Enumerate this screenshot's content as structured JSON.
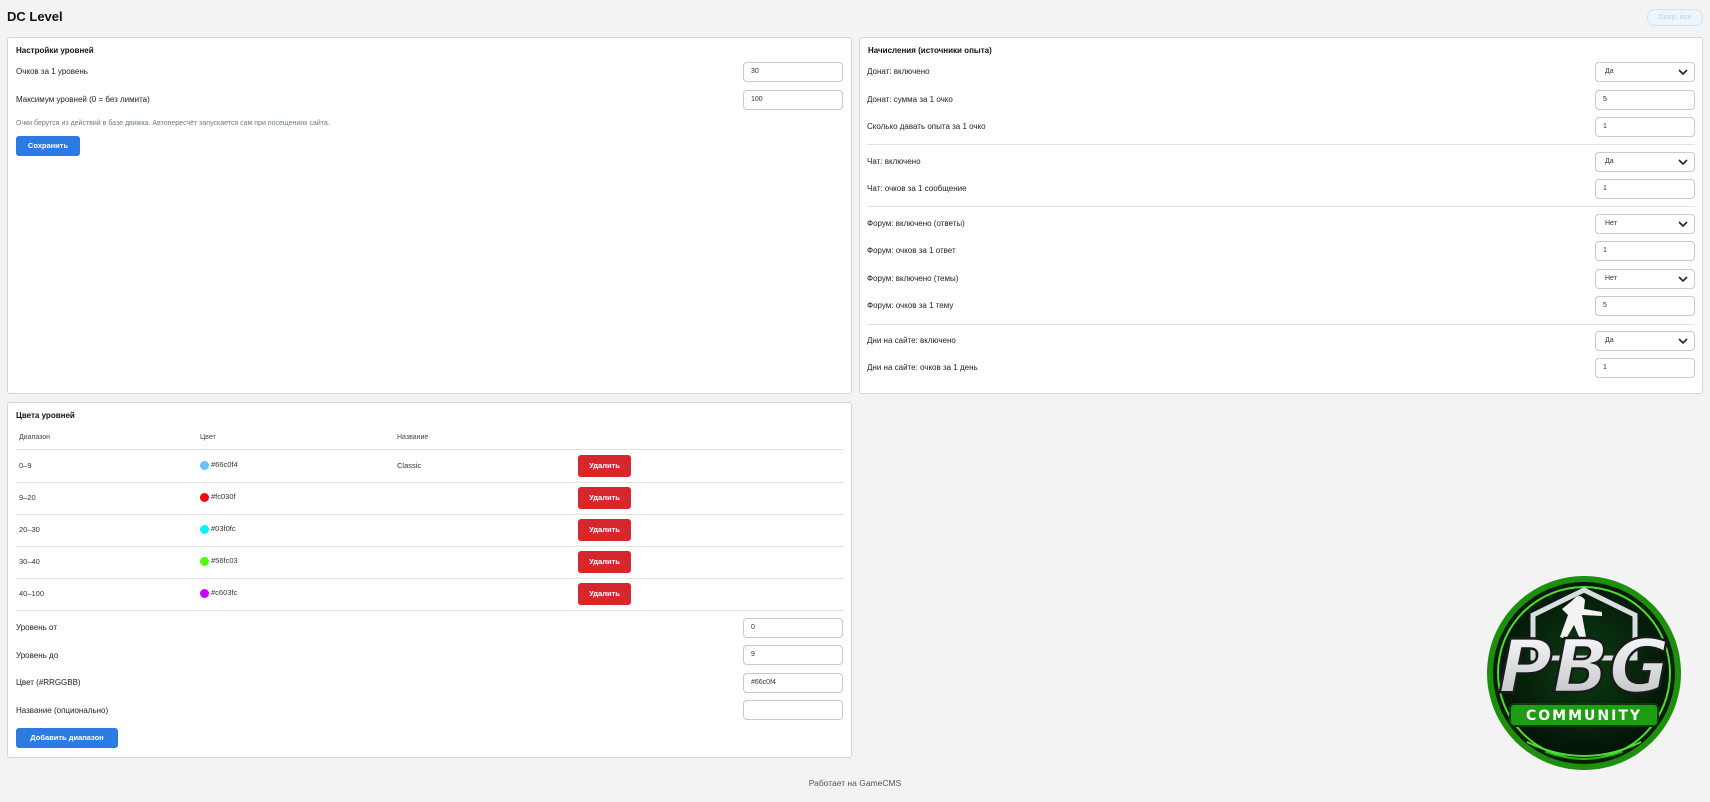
{
  "header": {
    "title": "DC Level",
    "top_button_label": "Сохр. все"
  },
  "level_settings": {
    "title": "Настройки уровней",
    "points_per_level": {
      "label": "Очков за 1 уровень",
      "value": "30"
    },
    "max_levels": {
      "label": "Максимум уровней (0 = без лимита)",
      "value": "100"
    },
    "hint": "Очки берутся из действий в базе движка. Автопересчёт запускается сам при посещениях сайта.",
    "save_label": "Сохранить"
  },
  "accruals": {
    "title": "Начисления (источники опыта)",
    "rows": [
      {
        "label": "Донат: включено",
        "type": "select",
        "value": "Да"
      },
      {
        "label": "Донат: сумма за 1 очко",
        "type": "input",
        "value": "5"
      },
      {
        "label": "Сколько давать опыта за 1 очко",
        "type": "input",
        "value": "1"
      },
      {
        "label": "Чат: включено",
        "type": "select",
        "value": "Да"
      },
      {
        "label": "Чат: очков за 1 сообщение",
        "type": "input",
        "value": "1"
      },
      {
        "label": "Форум: включено (ответы)",
        "type": "select",
        "value": "Нет"
      },
      {
        "label": "Форум: очков за 1 ответ",
        "type": "input",
        "value": "1"
      },
      {
        "label": "Форум: включено (темы)",
        "type": "select",
        "value": "Нет"
      },
      {
        "label": "Форум: очков за 1 тему",
        "type": "input",
        "value": "5"
      },
      {
        "label": "Дни на сайте: включено",
        "type": "select",
        "value": "Да"
      },
      {
        "label": "Дни на сайте: очков за 1 день",
        "type": "input",
        "value": "1"
      }
    ]
  },
  "level_colors": {
    "title": "Цвета уровней",
    "columns": [
      "Диапазон",
      "Цвет",
      "Название"
    ],
    "delete_label": "Удалить",
    "rows": [
      {
        "range": "0–9",
        "color": "#66c0f4",
        "name": "Classic"
      },
      {
        "range": "9–20",
        "color": "#fc030f",
        "name": ""
      },
      {
        "range": "20–30",
        "color": "#03f0fc",
        "name": ""
      },
      {
        "range": "30–40",
        "color": "#56fc03",
        "name": ""
      },
      {
        "range": "40–100",
        "color": "#c603fc",
        "name": ""
      }
    ],
    "form": {
      "level_from": {
        "label": "Уровень от",
        "value": "0"
      },
      "level_to": {
        "label": "Уровень до",
        "value": "9"
      },
      "color": {
        "label": "Цвет (#RRGGBB)",
        "value": "#66c0f4"
      },
      "name": {
        "label": "Название (опционально)",
        "value": ""
      }
    },
    "add_label": "Добавить диапазон"
  },
  "footer": {
    "text": "Работает на GameCMS"
  },
  "logo": {
    "main_text": "PBG",
    "sub_text": "COMMUNITY",
    "accent_color": "#39d21a"
  }
}
